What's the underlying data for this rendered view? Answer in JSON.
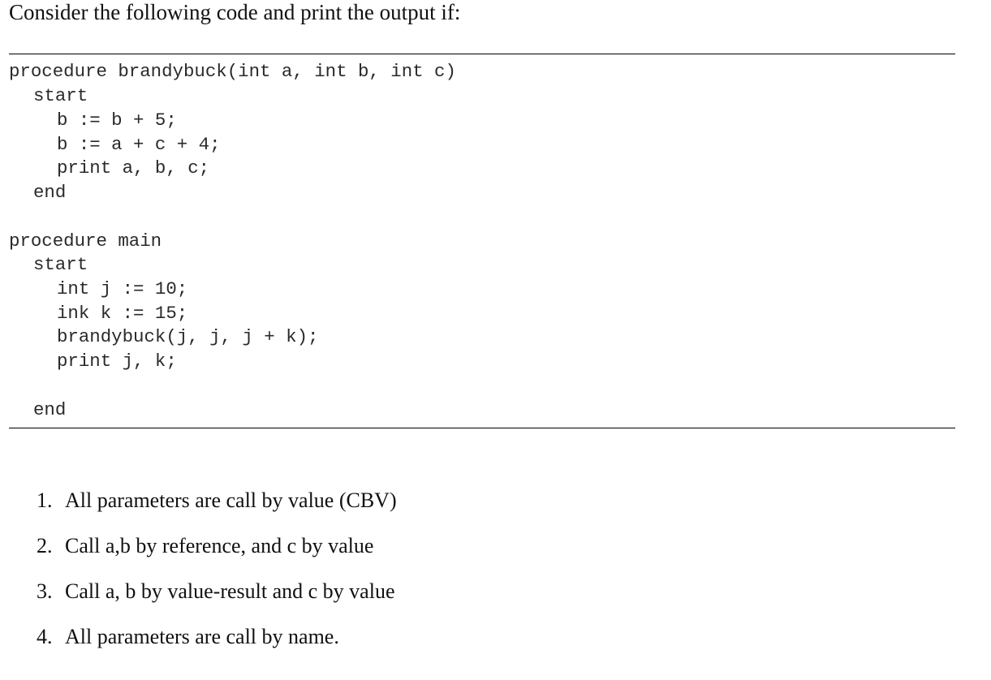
{
  "document": {
    "intro": "Consider the following code and print the output if:",
    "code": {
      "procedure_brandybuck": [
        {
          "indent": 0,
          "text": "procedure brandybuck(int a, int b, int c)"
        },
        {
          "indent": 1,
          "text": "start"
        },
        {
          "indent": 2,
          "text": "b := b + 5;"
        },
        {
          "indent": 2,
          "text": "b := a + c + 4;"
        },
        {
          "indent": 2,
          "text": "print a, b, c;"
        },
        {
          "indent": 1,
          "text": "end"
        }
      ],
      "procedure_main": [
        {
          "indent": 0,
          "text": "procedure main"
        },
        {
          "indent": 1,
          "text": "start"
        },
        {
          "indent": 2,
          "text": "int j := 10;"
        },
        {
          "indent": 2,
          "text": "ink k := 15;"
        },
        {
          "indent": 2,
          "text": "brandybuck(j, j, j + k);"
        },
        {
          "indent": 2,
          "text": "print j, k;"
        },
        {
          "indent": 0,
          "text": ""
        },
        {
          "indent": 1,
          "text": "end"
        }
      ]
    },
    "options": [
      {
        "number": "1.",
        "text": "All parameters are call by value (CBV)"
      },
      {
        "number": "2.",
        "text": "Call a,b by reference, and c by value"
      },
      {
        "number": "3.",
        "text": "Call a, b by value-result and c by value"
      },
      {
        "number": "4.",
        "text": "All parameters are call by name."
      }
    ]
  }
}
